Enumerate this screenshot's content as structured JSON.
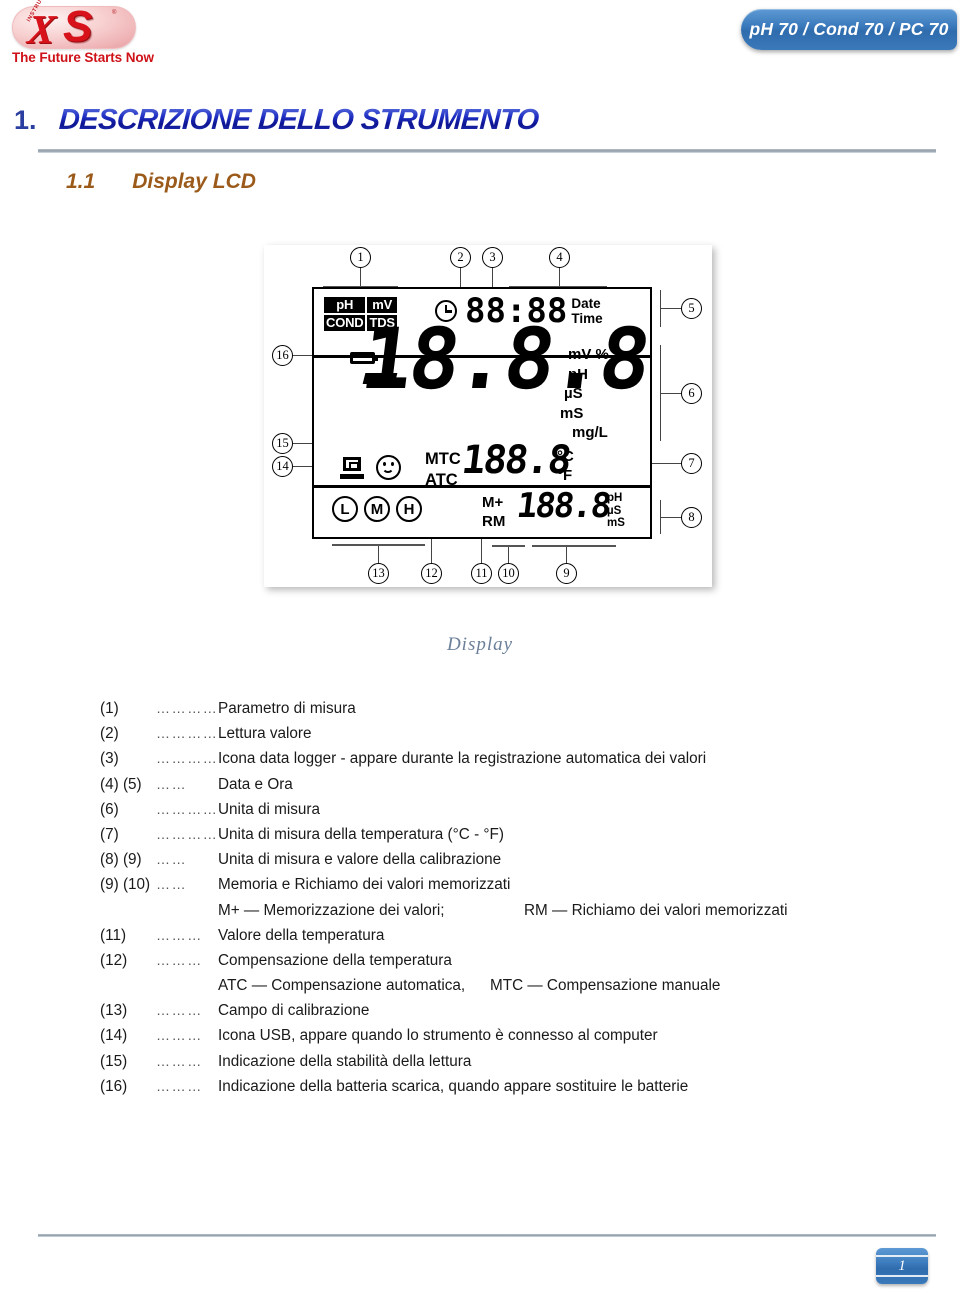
{
  "header": {
    "logo": {
      "mark_x": "X",
      "mark_s": "S",
      "instruments": "INSTRUMENTS",
      "registered": "®",
      "tagline": "The Future Starts Now"
    },
    "model_badge": "pH 70 / Cond 70 / PC 70"
  },
  "section": {
    "number": "1.",
    "title": "DESCRIZIONE DELLO STRUMENTO",
    "sub_number": "1.1",
    "sub_title": "Display LCD"
  },
  "figure": {
    "caption": "Display",
    "lcd": {
      "parameters": [
        "pH",
        "mV",
        "COND",
        "TDS"
      ],
      "clock_icon": "clock-icon",
      "time_value": "88:88",
      "date_label": "Date",
      "time_label": "Time",
      "battery_icon": "battery-low-icon",
      "main_sign": "-",
      "main_value": "18.8.8",
      "units": [
        "mV %",
        "pH",
        "µS",
        "mS",
        "mg/L"
      ],
      "usb_icon": "usb-computer-icon",
      "stability_icon": "smiley-stability-icon",
      "temp_comp_manual": "MTC",
      "temp_comp_auto": "ATC",
      "temp_value": "188.8",
      "temp_unit_c": "°C",
      "temp_unit_f": "°F",
      "calibration_range": [
        "L",
        "M",
        "H"
      ],
      "memory_store": "M+",
      "memory_recall": "RM",
      "memory_value": "188.8",
      "memory_units": [
        "pH",
        "µS",
        "mS"
      ]
    },
    "callouts": [
      {
        "id": "1",
        "label": "1"
      },
      {
        "id": "2",
        "label": "2"
      },
      {
        "id": "3",
        "label": "3"
      },
      {
        "id": "4",
        "label": "4"
      },
      {
        "id": "5",
        "label": "5"
      },
      {
        "id": "6",
        "label": "6"
      },
      {
        "id": "7",
        "label": "7"
      },
      {
        "id": "8",
        "label": "8"
      },
      {
        "id": "9",
        "label": "9"
      },
      {
        "id": "10",
        "label": "10"
      },
      {
        "id": "11",
        "label": "11"
      },
      {
        "id": "12",
        "label": "12"
      },
      {
        "id": "13",
        "label": "13"
      },
      {
        "id": "14",
        "label": "14"
      },
      {
        "id": "15",
        "label": "15"
      },
      {
        "id": "16",
        "label": "16"
      }
    ]
  },
  "legend": {
    "dots_long": "…………",
    "dots_med": "……",
    "dots_short": "………",
    "rows": [
      {
        "num": "(1)",
        "dots": "…………",
        "text": "Parametro di misura"
      },
      {
        "num": "(2)",
        "dots": "…………",
        "text": "Lettura valore"
      },
      {
        "num": "(3)",
        "dots": "…………",
        "text": "Icona data logger - appare durante la registrazione automatica dei valori"
      },
      {
        "num": "(4) (5)",
        "dots": "……",
        "text": "Data e Ora"
      },
      {
        "num": "(6)",
        "dots": "…………",
        "text": "Unita di misura"
      },
      {
        "num": "(7)",
        "dots": "…………",
        "text": "Unita di misura della temperatura (°C - °F)"
      },
      {
        "num": "(8) (9)",
        "dots": "……",
        "text": "Unita di misura e valore della calibrazione"
      },
      {
        "num": "(9) (10)",
        "dots": "……",
        "text": "Memoria e Richiamo dei valori memorizzati"
      },
      {
        "num": "(11)",
        "dots": "………",
        "text": "Valore della temperatura"
      },
      {
        "num": "(12)",
        "dots": "………",
        "text": "Compensazione della temperatura"
      },
      {
        "num": "(13)",
        "dots": "………",
        "text": "Campo di calibrazione"
      },
      {
        "num": "(14)",
        "dots": "………",
        "text": "Icona USB, appare quando lo strumento è connesso al computer"
      },
      {
        "num": "(15)",
        "dots": "………",
        "text": "Indicazione della stabilità della lettura"
      },
      {
        "num": "(16)",
        "dots": "………",
        "text": "Indicazione della batteria scarica, quando appare sostituire le batterie"
      }
    ],
    "memory_note_a": "M+ — Memorizzazione dei valori;",
    "memory_note_b": "RM — Richiamo dei valori memorizzati",
    "comp_note_a": "ATC — Compensazione automatica,",
    "comp_note_b": "MTC — Compensazione manuale"
  },
  "footer": {
    "page_number": "1"
  },
  "colors": {
    "brand_red": "#d8121a",
    "badge_blue": "#3d7cbe",
    "heading_blue": "#1423b4",
    "subheading_brown": "#9b5a1a",
    "caption_blue_gray": "#6b7f99"
  }
}
